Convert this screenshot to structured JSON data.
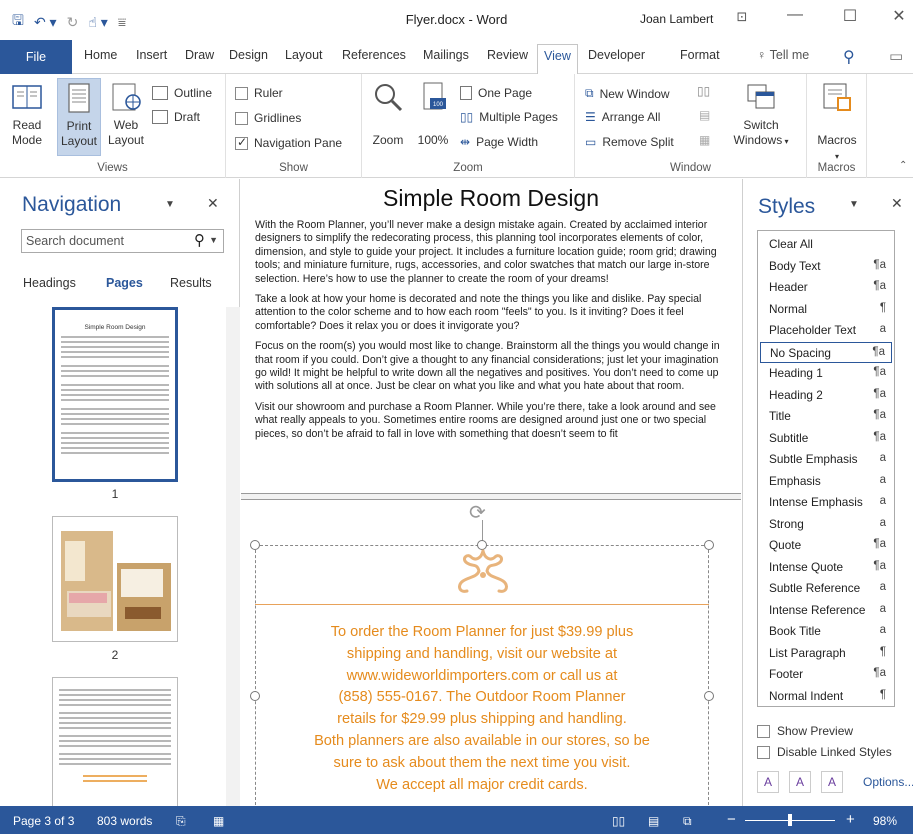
{
  "window": {
    "title": "Flyer.docx - Word",
    "user": "Joan Lambert",
    "controls": [
      "ribbon-display",
      "minimize",
      "maximize",
      "close"
    ]
  },
  "tabs": [
    "File",
    "Home",
    "Insert",
    "Draw",
    "Design",
    "Layout",
    "References",
    "Mailings",
    "Review",
    "View",
    "Developer",
    "Format"
  ],
  "tell_me": "Tell me",
  "ribbon": {
    "views": {
      "label": "Views",
      "read_mode": [
        "Read",
        "Mode"
      ],
      "print_layout": [
        "Print",
        "Layout"
      ],
      "web_layout": [
        "Web",
        "Layout"
      ],
      "outline": "Outline",
      "draft": "Draft"
    },
    "show": {
      "label": "Show",
      "ruler": "Ruler",
      "gridlines": "Gridlines",
      "navigation_pane": "Navigation Pane",
      "ruler_checked": false,
      "gridlines_checked": false,
      "navigation_pane_checked": true
    },
    "zoom": {
      "label": "Zoom",
      "zoom": "Zoom",
      "hundred": "100%",
      "one_page": "One Page",
      "multiple_pages": "Multiple Pages",
      "page_width": "Page Width"
    },
    "window": {
      "label": "Window",
      "new_window": "New Window",
      "arrange_all": "Arrange All",
      "remove_split": "Remove Split",
      "switch_windows": [
        "Switch",
        "Windows"
      ]
    },
    "macros": {
      "label": "Macros",
      "macros": "Macros"
    }
  },
  "navigation": {
    "title": "Navigation",
    "search_placeholder": "Search document",
    "tabs": [
      "Headings",
      "Pages",
      "Results"
    ],
    "selected_tab": "Pages",
    "thumb_title": "Simple Room Design",
    "page_numbers": [
      "1",
      "2"
    ]
  },
  "document": {
    "title": "Simple Room Design",
    "paragraphs": [
      "With the Room Planner, you’ll never make a design mistake again. Created by acclaimed interior designers to simplify the redecorating process, this planning tool incorporates elements of color, dimension, and style to guide your project. It includes a furniture location guide; room grid; drawing tools; and miniature furniture, rugs, accessories, and color swatches that match our large in-store selection. Here’s how to use the planner to create the room of your dreams!",
      "Take a look at how your home is decorated and note the things you like and dislike. Pay special attention to the color scheme and to how each room \"feels\" to you. Is it inviting? Does it feel comfortable? Does it relax you or does it invigorate you?",
      "Focus on the room(s) you would most like to change. Brainstorm all the things you would change in that room if you could. Don’t give a thought to any financial considerations; just let your imagination go wild! It might be helpful to write down all the negatives and positives. You don’t need to come up with solutions all at once. Just be clear on what you like and what you hate about that room.",
      "Visit our showroom and purchase a Room Planner. While you’re there, take a look around and see what really appeals to you. Sometimes entire rooms are designed around just one or two special pieces, so don’t be afraid to fall in love with something that doesn’t seem to fit"
    ],
    "flyer_lines": [
      "To order the Room Planner for just $39.99 plus",
      "shipping and handling, visit our website at",
      "www.wideworldimporters.com or call us at",
      "(858) 555-0167. The Outdoor Room Planner",
      "retails for $29.99 plus shipping and handling.",
      "Both planners are also available in our stores, so be",
      "sure to ask about them the next time you visit.",
      "We accept all major credit cards."
    ]
  },
  "styles": {
    "title": "Styles",
    "items": [
      {
        "name": "Clear All",
        "mark": ""
      },
      {
        "name": "Body Text",
        "mark": "¶a"
      },
      {
        "name": "Header",
        "mark": "¶a"
      },
      {
        "name": "Normal",
        "mark": "¶"
      },
      {
        "name": "Placeholder Text",
        "mark": "a"
      },
      {
        "name": "No Spacing",
        "mark": "¶a"
      },
      {
        "name": "Heading 1",
        "mark": "¶a"
      },
      {
        "name": "Heading 2",
        "mark": "¶a"
      },
      {
        "name": "Title",
        "mark": "¶a"
      },
      {
        "name": "Subtitle",
        "mark": "¶a"
      },
      {
        "name": "Subtle Emphasis",
        "mark": "a"
      },
      {
        "name": "Emphasis",
        "mark": "a"
      },
      {
        "name": "Intense Emphasis",
        "mark": "a"
      },
      {
        "name": "Strong",
        "mark": "a"
      },
      {
        "name": "Quote",
        "mark": "¶a"
      },
      {
        "name": "Intense Quote",
        "mark": "¶a"
      },
      {
        "name": "Subtle Reference",
        "mark": "a"
      },
      {
        "name": "Intense Reference",
        "mark": "a"
      },
      {
        "name": "Book Title",
        "mark": "a"
      },
      {
        "name": "List Paragraph",
        "mark": "¶"
      },
      {
        "name": "Footer",
        "mark": "¶a"
      },
      {
        "name": "Normal Indent",
        "mark": "¶"
      }
    ],
    "selected": "No Spacing",
    "show_preview": "Show Preview",
    "disable_linked": "Disable Linked Styles",
    "options": "Options..."
  },
  "status": {
    "page": "Page 3 of 3",
    "words": "803 words",
    "zoom": "98%",
    "zoom_level": 0.98
  },
  "colors": {
    "accent": "#2b579a",
    "flyer_orange": "#e58b1d"
  }
}
